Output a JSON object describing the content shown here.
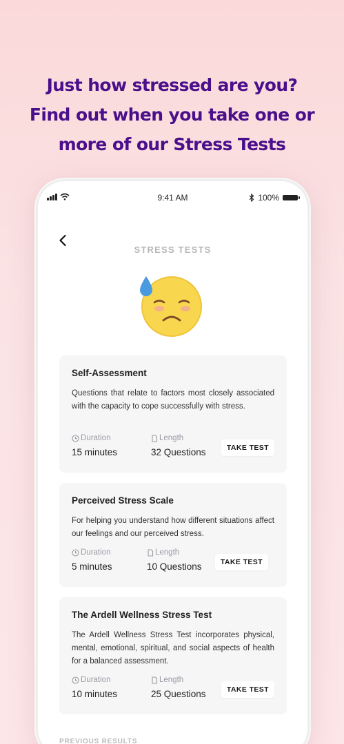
{
  "headline": {
    "line1": "Just how stressed are you?",
    "line2": "Find out when you take one or",
    "line3": "more of our Stress Tests"
  },
  "status_bar": {
    "time": "9:41 AM",
    "battery": "100%"
  },
  "page": {
    "title": "STRESS TESTS",
    "emoji": "downcast-face-with-sweat-icon"
  },
  "tests": [
    {
      "title": "Self-Assessment",
      "description": "Questions that relate to factors most closely associated with the capacity to cope successfully with stress.",
      "duration_label": "Duration",
      "duration": "15 minutes",
      "length_label": "Length",
      "length": "32 Questions",
      "button": "TAKE TEST"
    },
    {
      "title": "Perceived Stress Scale",
      "description": "For helping you understand how different situations affect our feelings and our perceived stress.",
      "duration_label": "Duration",
      "duration": "5 minutes",
      "length_label": "Length",
      "length": "10 Questions",
      "button": "TAKE TEST"
    },
    {
      "title": "The Ardell Wellness Stress Test",
      "description": "The Ardell Wellness Stress Test incorporates physical, mental, emotional, spiritual, and social aspects of health for a balanced assessment.",
      "duration_label": "Duration",
      "duration": "10 minutes",
      "length_label": "Length",
      "length": "25 Questions",
      "button": "TAKE TEST"
    }
  ],
  "previous_results_label": "PREVIOUS RESULTS",
  "colors": {
    "headline": "#4a0f8a",
    "emoji_face": "#f8d64e",
    "sweat": "#4a9ae0"
  }
}
